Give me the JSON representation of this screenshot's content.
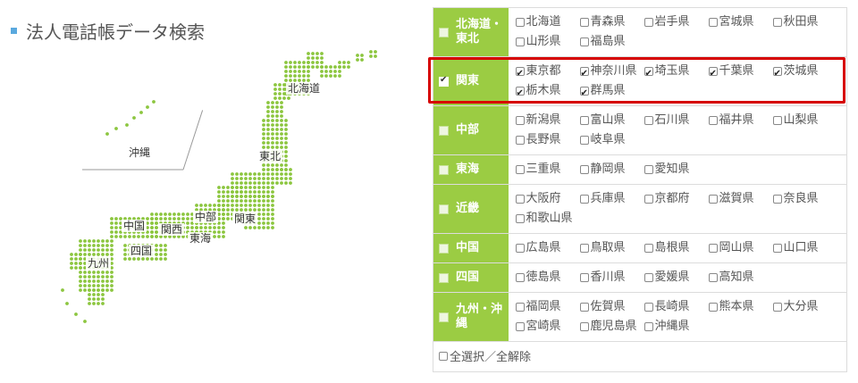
{
  "page": {
    "title": "法人電話帳データ検索"
  },
  "map": {
    "labels": {
      "hokkaido": "北海道",
      "tohoku": "東北",
      "okinawa": "沖縄",
      "chubu": "中部",
      "kanto": "関東",
      "kansai": "関西",
      "tokai": "東海",
      "chugoku": "中国",
      "shikoku": "四国",
      "kyushu": "九州"
    },
    "color": "#8cc63f"
  },
  "regions": [
    {
      "name": "北海道・東北",
      "checked": false,
      "prefectures": [
        {
          "label": "北海道",
          "checked": false
        },
        {
          "label": "青森県",
          "checked": false
        },
        {
          "label": "岩手県",
          "checked": false
        },
        {
          "label": "宮城県",
          "checked": false
        },
        {
          "label": "秋田県",
          "checked": false
        },
        {
          "label": "山形県",
          "checked": false
        },
        {
          "label": "福島県",
          "checked": false
        }
      ]
    },
    {
      "name": "関東",
      "checked": true,
      "prefectures": [
        {
          "label": "東京都",
          "checked": true
        },
        {
          "label": "神奈川県",
          "checked": true
        },
        {
          "label": "埼玉県",
          "checked": true
        },
        {
          "label": "千葉県",
          "checked": true
        },
        {
          "label": "茨城県",
          "checked": true
        },
        {
          "label": "栃木県",
          "checked": true
        },
        {
          "label": "群馬県",
          "checked": true
        }
      ]
    },
    {
      "name": "中部",
      "checked": false,
      "prefectures": [
        {
          "label": "新潟県",
          "checked": false
        },
        {
          "label": "富山県",
          "checked": false
        },
        {
          "label": "石川県",
          "checked": false
        },
        {
          "label": "福井県",
          "checked": false
        },
        {
          "label": "山梨県",
          "checked": false
        },
        {
          "label": "長野県",
          "checked": false
        },
        {
          "label": "岐阜県",
          "checked": false
        }
      ]
    },
    {
      "name": "東海",
      "checked": false,
      "prefectures": [
        {
          "label": "三重県",
          "checked": false
        },
        {
          "label": "静岡県",
          "checked": false
        },
        {
          "label": "愛知県",
          "checked": false
        }
      ]
    },
    {
      "name": "近畿",
      "checked": false,
      "prefectures": [
        {
          "label": "大阪府",
          "checked": false
        },
        {
          "label": "兵庫県",
          "checked": false
        },
        {
          "label": "京都府",
          "checked": false
        },
        {
          "label": "滋賀県",
          "checked": false
        },
        {
          "label": "奈良県",
          "checked": false
        },
        {
          "label": "和歌山県",
          "checked": false
        }
      ]
    },
    {
      "name": "中国",
      "checked": false,
      "prefectures": [
        {
          "label": "広島県",
          "checked": false
        },
        {
          "label": "鳥取県",
          "checked": false
        },
        {
          "label": "島根県",
          "checked": false
        },
        {
          "label": "岡山県",
          "checked": false
        },
        {
          "label": "山口県",
          "checked": false
        }
      ]
    },
    {
      "name": "四国",
      "checked": false,
      "prefectures": [
        {
          "label": "徳島県",
          "checked": false
        },
        {
          "label": "香川県",
          "checked": false
        },
        {
          "label": "愛媛県",
          "checked": false
        },
        {
          "label": "高知県",
          "checked": false
        }
      ]
    },
    {
      "name": "九州・沖縄",
      "checked": false,
      "prefectures": [
        {
          "label": "福岡県",
          "checked": false
        },
        {
          "label": "佐賀県",
          "checked": false
        },
        {
          "label": "長崎県",
          "checked": false
        },
        {
          "label": "熊本県",
          "checked": false
        },
        {
          "label": "大分県",
          "checked": false
        },
        {
          "label": "宮崎県",
          "checked": false
        },
        {
          "label": "鹿児島県",
          "checked": false
        },
        {
          "label": "沖縄県",
          "checked": false
        }
      ]
    }
  ],
  "select_all": {
    "label": "全選択／全解除",
    "checked": false
  },
  "highlight_color": "#d60000"
}
